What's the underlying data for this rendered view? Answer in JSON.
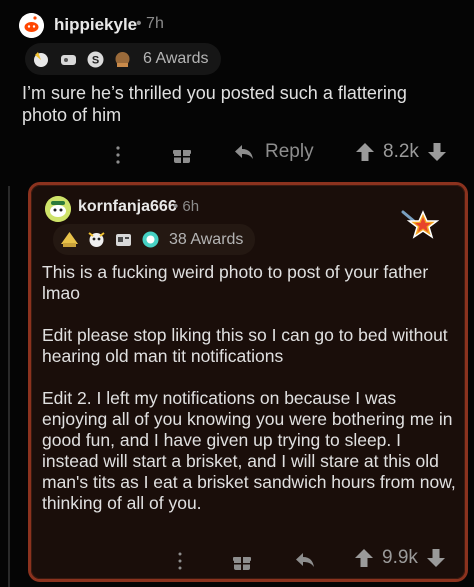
{
  "comment": {
    "username": "hippiekyle",
    "age": "• 7h",
    "awards_count": "6 Awards",
    "body": "I’m sure he’s thrilled you posted such a flattering photo of him",
    "reply_label": "Reply",
    "score": "8.2k"
  },
  "reply": {
    "username": "kornfanja666",
    "age": "• 6h",
    "awards_count": "38 Awards",
    "paragraphs": [
      "This is a fucking weird photo to post of your father lmao",
      "Edit please stop liking this so I can go to bed without hearing old man tit notifications",
      "Edit 2.  I left my notifications on because I was enjoying all of you knowing you were bothering me in good fun, and I have given up trying to sleep.  I instead will start a brisket, and I will stare at this old man's tits as I eat a brisket sandwich hours from now, thinking of all of you."
    ],
    "score": "9.9k"
  },
  "colors": {
    "background": "#050505",
    "highlight_border": "#8b321e",
    "highlight_bg": "#1a0e0a",
    "text": "#e0e0e0",
    "muted": "#8e8e8e"
  },
  "icons": [
    "snoo-avatar-icon",
    "award-icon",
    "more-options-icon",
    "gift-icon",
    "reply-arrow-icon",
    "upvote-icon",
    "downvote-icon",
    "star-award-icon"
  ]
}
